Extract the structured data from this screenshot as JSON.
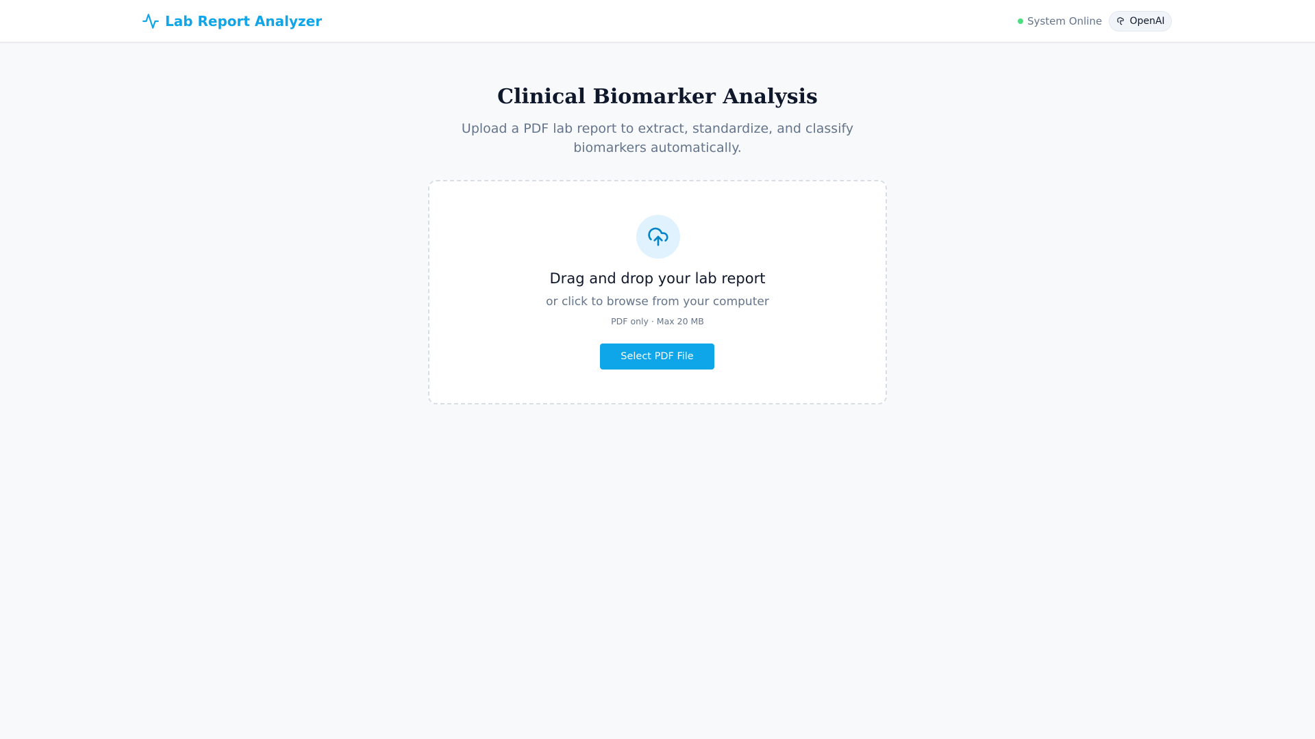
{
  "header": {
    "title": "Lab Report Analyzer",
    "logo_icon": "activity-pulse-icon",
    "status_text": "System Online",
    "status_color": "#4ade80",
    "provider_label": "OpenAI",
    "provider_icon": "openai-icon"
  },
  "main": {
    "title": "Clinical Biomarker Analysis",
    "subtitle": "Upload a PDF lab report to extract, standardize, and classify biomarkers automatically."
  },
  "upload": {
    "icon": "cloud-upload-icon",
    "title": "Drag and drop your lab report",
    "subtitle": "or click to browse from your computer",
    "hint": "PDF only · Max 20 MB",
    "button_label": "Select PDF File"
  },
  "colors": {
    "accent": "#0ea5e9",
    "background": "#f8f9fb",
    "muted_text": "#64748b"
  }
}
